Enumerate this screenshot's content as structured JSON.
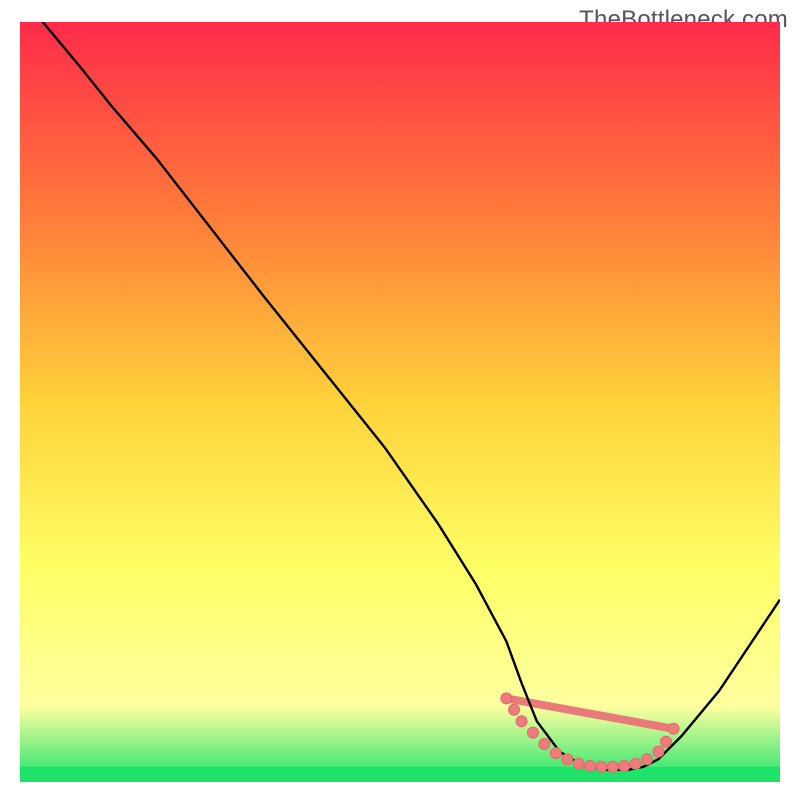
{
  "watermark": "TheBottleneck.com",
  "colors": {
    "grad_top": "#ff2b4a",
    "grad_mid_upper": "#ff7a3a",
    "grad_mid": "#ffd23a",
    "grad_mid_lower": "#ffff66",
    "grad_low": "#ffffa0",
    "grad_bottom": "#1de36b",
    "curve": "#000000",
    "marker_fill": "#ef7b7b",
    "marker_stroke": "#de6b6b",
    "bottom_line": "#e87a7a"
  },
  "chart_data": {
    "type": "line",
    "title": "",
    "xlabel": "",
    "ylabel": "",
    "xlim": [
      0,
      100
    ],
    "ylim": [
      0,
      100
    ],
    "series": [
      {
        "name": "curve",
        "x": [
          0,
          3,
          8,
          12,
          18,
          25,
          32,
          40,
          48,
          55,
          60,
          64,
          66,
          68,
          71,
          74,
          77,
          80,
          82,
          84,
          87,
          92,
          100
        ],
        "y": [
          105,
          100,
          94,
          89,
          82,
          73,
          64,
          54,
          44,
          34,
          26,
          18.5,
          13,
          8,
          4,
          2.2,
          1.6,
          1.6,
          2,
          3,
          6,
          12,
          24
        ]
      }
    ],
    "markers": {
      "name": "bottom-cluster",
      "x": [
        64,
        65,
        66,
        67.5,
        69,
        70.5,
        72,
        73.5,
        75,
        76.5,
        78,
        79.5,
        81,
        82.5,
        84,
        85,
        86
      ],
      "y": [
        11,
        9.5,
        8,
        6.5,
        5,
        3.8,
        3,
        2.4,
        2.1,
        2,
        2,
        2.1,
        2.4,
        3,
        4,
        5.3,
        7
      ]
    },
    "green_band": {
      "y0": 0,
      "y1": 2
    }
  }
}
